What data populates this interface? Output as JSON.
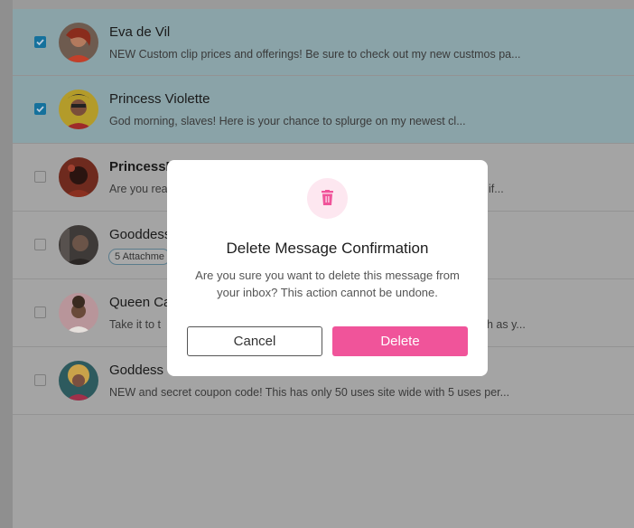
{
  "messages": [
    {
      "name": "Eva de Vil",
      "preview": "NEW Custom clip prices and offerings! Be sure to check out my new custmos pa...",
      "checked": true
    },
    {
      "name": "Princess Violette",
      "preview": "God morning, slaves! Here is your chance to splurge on my newest cl...",
      "checked": true
    },
    {
      "name": "PrincessP",
      "preview": "Are you rea",
      "preview_right": "if...",
      "checked": false
    },
    {
      "name": "Gooddess",
      "attachment": "5 Attachme",
      "checked": false
    },
    {
      "name": "Queen Ca",
      "preview": "Take it to t",
      "preview_right": "h as y...",
      "checked": false
    },
    {
      "name": "Goddess",
      "preview": "NEW and secret coupon code! This has only 50 uses site wide with 5 uses per...",
      "checked": false
    }
  ],
  "modal": {
    "title": "Delete Message Confirmation",
    "body": "Are you sure you want to delete this message from your inbox? This action cannot be undone.",
    "cancel_label": "Cancel",
    "delete_label": "Delete",
    "icon": "trash-icon"
  },
  "colors": {
    "accent": "#f0549a",
    "checkbox": "#15719c"
  }
}
